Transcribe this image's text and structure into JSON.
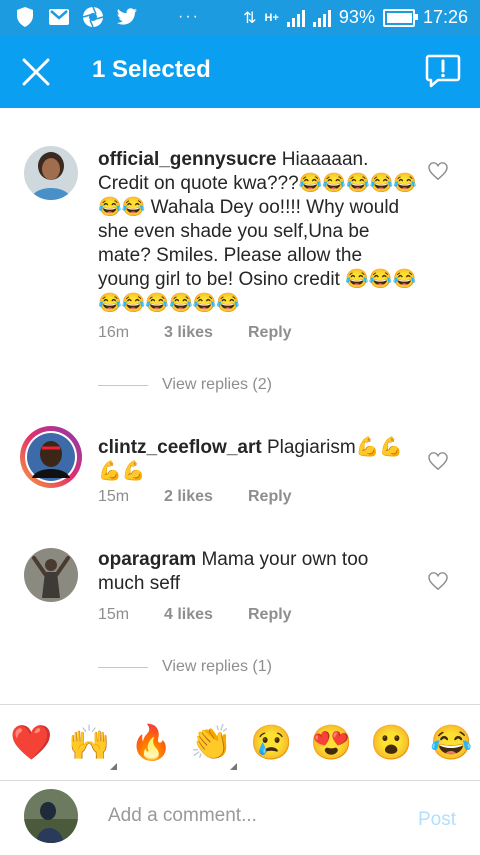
{
  "status_bar": {
    "battery_percent": "93%",
    "time": "17:26",
    "network_label": "H+",
    "dots": "···"
  },
  "app_bar": {
    "title": "1 Selected",
    "close_icon": "close-icon",
    "report_icon": "report-icon"
  },
  "comments": [
    {
      "username": "official_gennysucre",
      "text": "Hiaaaaan. Credit on quote kwa???😂😂😂😂😂😂😂 Wahala Dey oo!!!! Why would she even shade you self,Una be mate? Smiles.  Please allow the young girl to be! Osino credit 😂😂😂😂😂😂😂😂😂",
      "time": "16m",
      "likes": "3 likes",
      "reply": "Reply",
      "view_replies": "View replies (2)"
    },
    {
      "username": "clintz_ceeflow_art",
      "text": "Plagiarism💪💪💪💪",
      "time": "15m",
      "likes": "2 likes",
      "reply": "Reply"
    },
    {
      "username": "oparagram",
      "text": "Mama your own too much seff",
      "time": "15m",
      "likes": "4 likes",
      "reply": "Reply",
      "view_replies": "View replies (1)"
    }
  ],
  "emoji_bar": [
    "❤️",
    "🙌",
    "🔥",
    "👏",
    "😢",
    "😍",
    "😮",
    "😂"
  ],
  "composer": {
    "placeholder": "Add a comment...",
    "post_label": "Post"
  }
}
